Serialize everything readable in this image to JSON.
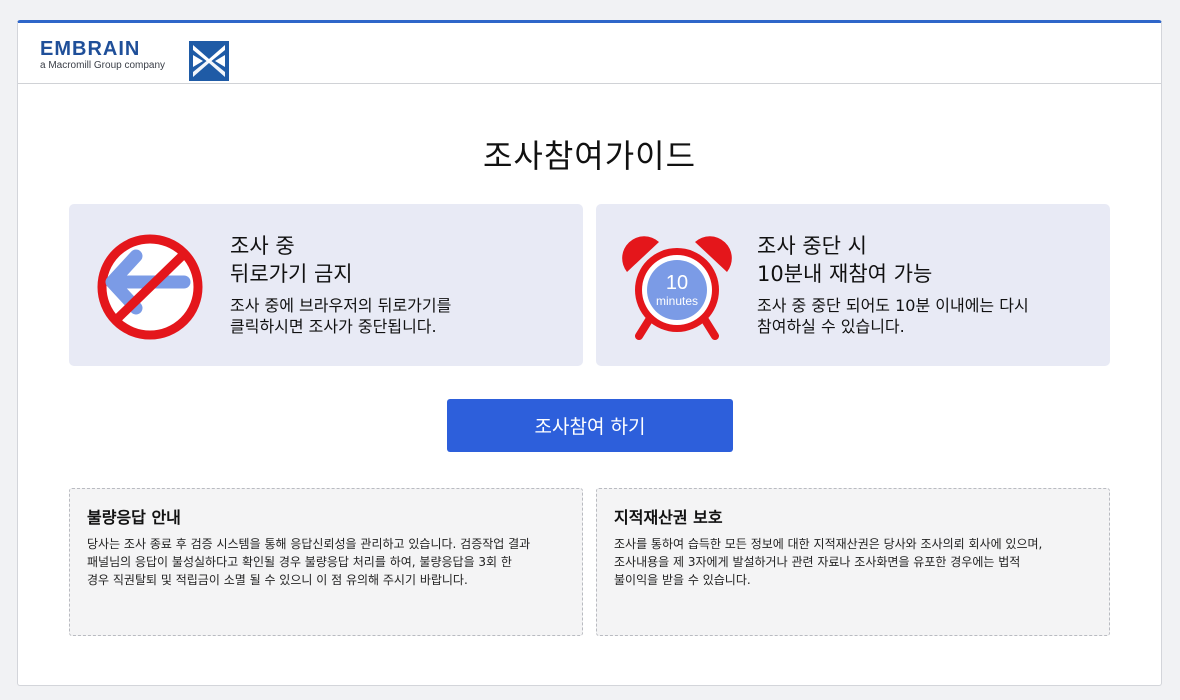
{
  "header": {
    "brand_name": "EMBRAIN",
    "brand_tagline": "a Macromill Group company",
    "logo_icon": "embrain-mark-icon"
  },
  "page_title": "조사참여가이드",
  "cards": [
    {
      "icon": "no-back-arrow-icon",
      "heading_line1": "조사 중",
      "heading_line2": "뒤로가기 금지",
      "desc_line1": "조사 중에 브라우저의 뒤로가기를",
      "desc_line2": "클릭하시면 조사가 중단됩니다."
    },
    {
      "icon": "alarm-clock-icon",
      "clock_number": "10",
      "clock_unit": "minutes",
      "heading_line1": "조사 중단 시",
      "heading_line2": "10분내 재참여 가능",
      "desc_line1": "조사 중 중단 되어도 10분 이내에는 다시",
      "desc_line2": "참여하실 수 있습니다."
    }
  ],
  "cta_label": "조사참여 하기",
  "notices": [
    {
      "title": "불량응답 안내",
      "line1": "당사는 조사 종료 후 검증 시스템을 통해 응답신뢰성을 관리하고 있습니다. 검증작업 결과",
      "line2": "패널님의 응답이 불성실하다고 확인될 경우 불량응답 처리를 하여, 불량응답을 3회 한",
      "line3": "경우 직권탈퇴 및 적립금이 소멸 될 수 있으니 이 점 유의해 주시기 바랍니다."
    },
    {
      "title": "지적재산권 보호",
      "line1": "조사를 통하여 습득한 모든 정보에 대한 지적재산권은 당사와 조사의뢰 회사에 있으며,",
      "line2": "조사내용을 제 3자에게 발설하거나 관련 자료나 조사화면을 유포한 경우에는 법적",
      "line3": "불이익을 받을 수 있습니다."
    }
  ],
  "colors": {
    "accent_blue": "#2d5fdb",
    "top_border": "#2f66c9",
    "card_bg": "#e8eaf5",
    "prohibition_red": "#e4161b",
    "arrow_blue": "#7b9be6"
  }
}
